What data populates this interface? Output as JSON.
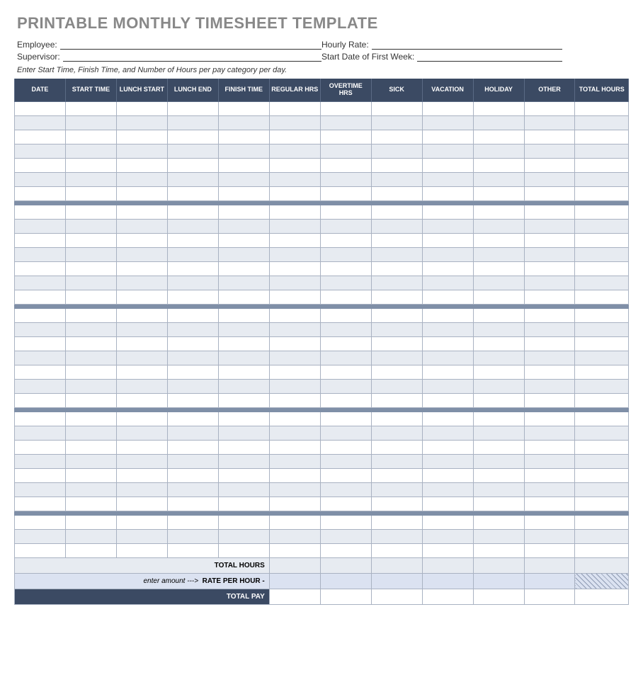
{
  "title": "PRINTABLE MONTHLY TIMESHEET TEMPLATE",
  "meta": {
    "employee_label": "Employee:",
    "hourly_rate_label": "Hourly Rate:",
    "supervisor_label": "Supervisor:",
    "start_date_label": "Start Date of First Week:"
  },
  "instruction": "Enter Start Time, Finish Time, and Number of Hours per pay category per day.",
  "columns": [
    "DATE",
    "START TIME",
    "LUNCH START",
    "LUNCH END",
    "FINISH TIME",
    "REGULAR HRS",
    "OVERTIME HRS",
    "SICK",
    "VACATION",
    "HOLIDAY",
    "OTHER",
    "TOTAL HOURS"
  ],
  "weeks_structure": [
    7,
    7,
    7,
    7,
    3
  ],
  "summary": {
    "total_hours_label": "TOTAL HOURS",
    "rate_hint": "enter amount --->",
    "rate_label": "RATE PER HOUR -",
    "total_pay_label": "TOTAL PAY"
  }
}
